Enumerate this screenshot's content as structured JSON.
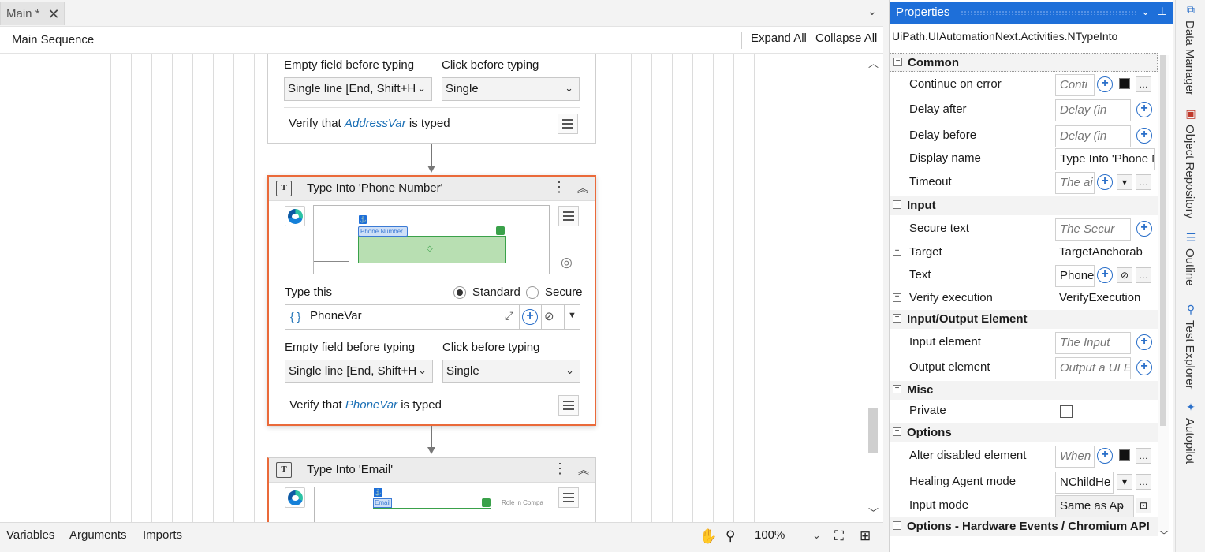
{
  "tabs": {
    "main_label": "Main *"
  },
  "breadcrumb": {
    "label": "Main Sequence",
    "expand_all": "Expand All",
    "collapse_all": "Collapse All"
  },
  "address_card": {
    "empty_field_label": "Empty field before typing",
    "empty_field_value": "Single line [End, Shift+H",
    "click_label": "Click before typing",
    "click_value": "Single",
    "verify_prefix": "Verify that",
    "verify_var": "AddressVar",
    "verify_suffix": "is typed"
  },
  "phone_card": {
    "title": "Type Into 'Phone Number'",
    "anchor_label": "Phone Number",
    "type_this_label": "Type this",
    "radio_standard": "Standard",
    "radio_secure": "Secure",
    "value_icon": "{ }",
    "value": "PhoneVar",
    "empty_field_label": "Empty field before typing",
    "empty_field_value": "Single line [End, Shift+H",
    "click_label": "Click before typing",
    "click_value": "Single",
    "verify_prefix": "Verify that",
    "verify_var": "PhoneVar",
    "verify_suffix": "is typed"
  },
  "email_card": {
    "title": "Type Into 'Email'",
    "anchor_label": "Email",
    "side_text": "Role in Compa"
  },
  "bottom": {
    "variables": "Variables",
    "arguments": "Arguments",
    "imports": "Imports",
    "zoom": "100%"
  },
  "properties": {
    "title": "Properties",
    "type_name": "UiPath.UIAutomationNext.Activities.NTypeInto",
    "categories": {
      "common": "Common",
      "input": "Input",
      "io": "Input/Output Element",
      "misc": "Misc",
      "options": "Options",
      "hw": "Options - Hardware Events / Chromium API"
    },
    "rows": {
      "continue_on_error": {
        "name": "Continue on error",
        "value": "Conti"
      },
      "delay_after": {
        "name": "Delay after",
        "value": "Delay (in"
      },
      "delay_before": {
        "name": "Delay before",
        "value": "Delay (in"
      },
      "display_name": {
        "name": "Display name",
        "value": "Type Into 'Phone N"
      },
      "timeout": {
        "name": "Timeout",
        "value": "The ai"
      },
      "secure_text": {
        "name": "Secure text",
        "value": "The Secur"
      },
      "target": {
        "name": "Target",
        "value": "TargetAnchorab"
      },
      "text": {
        "name": "Text",
        "value": "Phone"
      },
      "verify_execution": {
        "name": "Verify execution",
        "value": "VerifyExecution"
      },
      "input_element": {
        "name": "Input element",
        "value": "The Input"
      },
      "output_element": {
        "name": "Output element",
        "value": "Output a UI E"
      },
      "private": {
        "name": "Private"
      },
      "alter_disabled": {
        "name": "Alter disabled element",
        "value": "When"
      },
      "healing_agent": {
        "name": "Healing Agent mode",
        "value": "NChildHe"
      },
      "input_mode": {
        "name": "Input mode",
        "value": "Same as Ap"
      }
    }
  },
  "dock": {
    "data_manager": "Data Manager",
    "object_repository": "Object Repository",
    "outline": "Outline",
    "test_explorer": "Test Explorer",
    "autopilot": "Autopilot"
  },
  "colors": {
    "accent": "#1e6fd9",
    "selected_border": "#ea6a3a",
    "variable": "#1a6fb5",
    "target_fill": "#b8dfb2"
  }
}
